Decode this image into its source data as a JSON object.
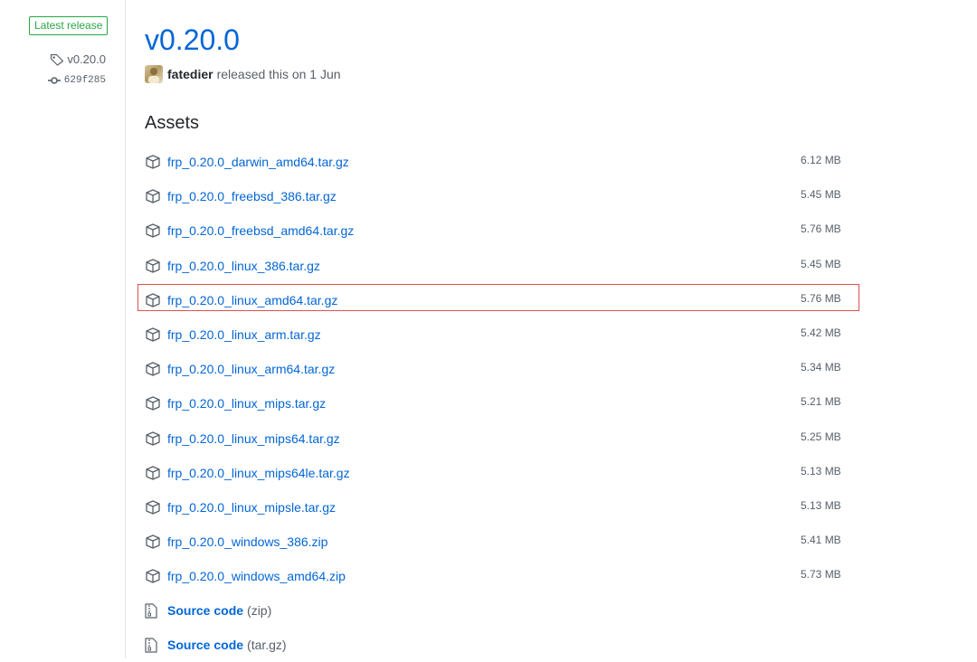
{
  "sidebar": {
    "badge": "Latest release",
    "tag": "v0.20.0",
    "commit": "629f285"
  },
  "release": {
    "title": "v0.20.0",
    "author": "fatedier",
    "released_text": "released this on 1 Jun"
  },
  "assets": {
    "heading": "Assets",
    "items": [
      {
        "name": "frp_0.20.0_darwin_amd64.tar.gz",
        "size": "6.12 MB"
      },
      {
        "name": "frp_0.20.0_freebsd_386.tar.gz",
        "size": "5.45 MB"
      },
      {
        "name": "frp_0.20.0_freebsd_amd64.tar.gz",
        "size": "5.76 MB"
      },
      {
        "name": "frp_0.20.0_linux_386.tar.gz",
        "size": "5.45 MB"
      },
      {
        "name": "frp_0.20.0_linux_amd64.tar.gz",
        "size": "5.76 MB"
      },
      {
        "name": "frp_0.20.0_linux_arm.tar.gz",
        "size": "5.42 MB"
      },
      {
        "name": "frp_0.20.0_linux_arm64.tar.gz",
        "size": "5.34 MB"
      },
      {
        "name": "frp_0.20.0_linux_mips.tar.gz",
        "size": "5.21 MB"
      },
      {
        "name": "frp_0.20.0_linux_mips64.tar.gz",
        "size": "5.25 MB"
      },
      {
        "name": "frp_0.20.0_linux_mips64le.tar.gz",
        "size": "5.13 MB"
      },
      {
        "name": "frp_0.20.0_linux_mipsle.tar.gz",
        "size": "5.13 MB"
      },
      {
        "name": "frp_0.20.0_windows_386.zip",
        "size": "5.41 MB"
      },
      {
        "name": "frp_0.20.0_windows_amd64.zip",
        "size": "5.73 MB"
      }
    ],
    "source": [
      {
        "label": "Source code",
        "format": "(zip)"
      },
      {
        "label": "Source code",
        "format": "(tar.gz)"
      }
    ]
  },
  "colors": {
    "link": "#0366d6",
    "badge_green": "#28a745",
    "highlight_red": "#d9534f"
  }
}
